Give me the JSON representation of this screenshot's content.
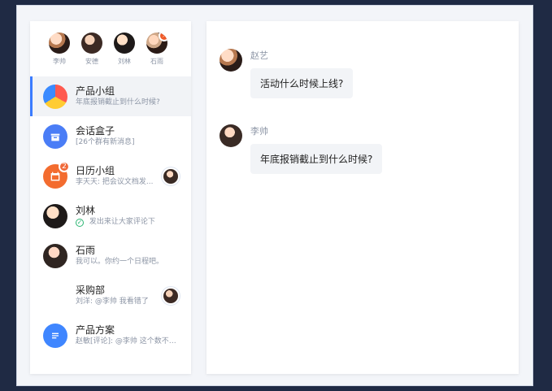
{
  "quick_contacts": [
    {
      "name": "李帅"
    },
    {
      "name": "安德"
    },
    {
      "name": "刘林"
    },
    {
      "name": "石雨",
      "badge": "⚡"
    }
  ],
  "conversations": [
    {
      "title": "产品小组",
      "subtitle": "年底报销截止到什么时候?"
    },
    {
      "title": "会话盒子",
      "subtitle": "[26个群有新消息]"
    },
    {
      "title": "日历小组",
      "subtitle": "李天天: 把会议文档发...",
      "count": "2"
    },
    {
      "title": "刘林",
      "subtitle": "发出来让大家评论下"
    },
    {
      "title": "石雨",
      "subtitle": "我可以。你约一个日程吧。"
    },
    {
      "title": "采购部",
      "subtitle": "刘洋: @李帅 我看错了"
    },
    {
      "title": "产品方案",
      "subtitle": "赵敏[评论]: @李帅 这个数不对吧"
    }
  ],
  "messages": [
    {
      "sender": "赵艺",
      "text": "活动什么时候上线?"
    },
    {
      "sender": "李帅",
      "text": "年底报销截止到什么时候?"
    }
  ],
  "icons": {
    "box": "box-icon",
    "calendar": "calendar-icon",
    "doc": "document-icon"
  },
  "colors": {
    "accent": "#3b7cff",
    "navy": "#1f2a44",
    "orange": "#f05a28"
  }
}
